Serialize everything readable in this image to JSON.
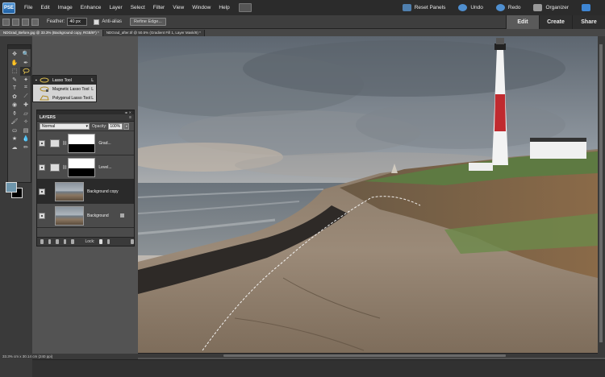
{
  "app": {
    "logo_text": "PSE"
  },
  "menu": [
    "File",
    "Edit",
    "Image",
    "Enhance",
    "Layer",
    "Select",
    "Filter",
    "View",
    "Window",
    "Help"
  ],
  "menu_right": {
    "reset_panels": "Reset Panels",
    "undo": "Undo",
    "redo": "Redo",
    "organizer": "Organizer"
  },
  "mode_tabs": [
    "Edit",
    "Create",
    "Share"
  ],
  "options_bar": {
    "feather_label": "Feather:",
    "feather_value": "40 px",
    "anti_alias_label": "Anti-alias",
    "refine_edge_label": "Refine Edge..."
  },
  "doc_tabs": [
    "NDGrad_Before.jpg @ 33.3% (Background copy, RGB/8*) *",
    "NDGrad_after.tif @ 50.5% (Gradient Fill 1, Layer Mask/8) *"
  ],
  "flyout": {
    "items": [
      {
        "label": "Lasso Tool",
        "key": "L"
      },
      {
        "label": "Magnetic Lasso Tool",
        "key": "L"
      },
      {
        "label": "Polygonal Lasso Tool",
        "key": "L"
      }
    ]
  },
  "layers_panel": {
    "title": "LAYERS",
    "blend_mode": "Normal",
    "opacity_label": "Opacity:",
    "opacity_value": "100%",
    "layers": [
      {
        "name": "Grad..."
      },
      {
        "name": "Level..."
      },
      {
        "name": "Background copy"
      },
      {
        "name": "Background"
      }
    ],
    "lock_label": "Lock:"
  },
  "status": {
    "text": "33.3% cm x 30.14 cm (240 ppi)"
  },
  "colors": {
    "foreground": "#6e96ac",
    "background": "#000000"
  }
}
